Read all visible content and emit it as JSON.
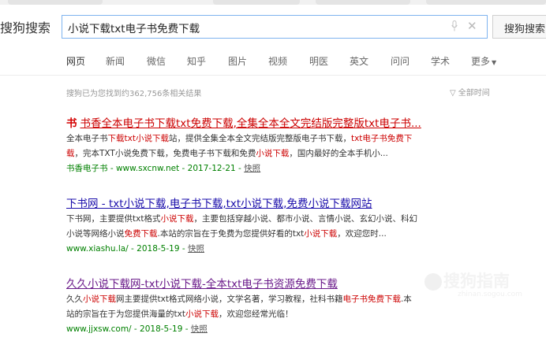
{
  "brand": "搜狗搜索",
  "search": {
    "query": "小说下载txt电子书免费下载",
    "button": "搜狗搜索"
  },
  "nav": [
    "网页",
    "新闻",
    "微信",
    "知乎",
    "图片",
    "视频",
    "明医",
    "英文",
    "问问",
    "学术",
    "更多"
  ],
  "stats": "搜狗已为您找到约362,756条相关结果",
  "time_filter": "全部时间",
  "results": [
    {
      "icon": "书",
      "title_parts": [
        "书香全本电子书下载txt免费下载,全集全本全文完结版完整版txt电子书..."
      ],
      "snippet_l1": [
        "全本电子书",
        "下载txt小说下载",
        "站，提供全集全本全文完结版完整版电子书下载，",
        "txt电子书免费下"
      ],
      "snippet_l2": [
        "载",
        "，完本TXT小说免费下载，免费电子书下载和免费",
        "小说下载",
        "，国内最好的全本手机小..."
      ],
      "url": "书香电子书 - www.sxcnw.net - 2017-12-21 - ",
      "cache": "快照"
    },
    {
      "title": "下书网 - txt小说下载,电子书下载,txt小说下载,免费小说下载网站",
      "snippet_l1": [
        "下书网，主要提供txt格式",
        "小说下载",
        "，主要包括穿越小说、都市小说、言情小说、玄幻小说、科幻"
      ],
      "snippet_l2": [
        "小说等网络小说",
        "免费下载",
        ".本站的宗旨在于免费为您提供好看的txt",
        "小说下载",
        "，欢迎您时..."
      ],
      "url": "www.xiashu.la/ - 2018-5-19 - ",
      "cache": "快照"
    },
    {
      "title": "久久小说下载网-txt小说下载-全本txt电子书资源免费下载",
      "snippet_l1": [
        "久久",
        "小说下载",
        "网主要提供txt格式网络小说，文学名著，学习教程，社科书籍",
        "电子书免费下载",
        ".本"
      ],
      "snippet_l2": [
        "站的宗旨在于为您提供海量的txt",
        "小说下载",
        "，欢迎您经常光临！"
      ],
      "url": "www.jjxsw.com/ - 2018-5-19 - ",
      "cache": "快照"
    }
  ],
  "watermark": "搜狗指南",
  "watermark_sub": "zhinan.sogou.com",
  "colors": {
    "title_link": "#1a0dab",
    "highlight": "#c00000",
    "url_green": "#008000",
    "search_border": "#7eb3ef"
  }
}
